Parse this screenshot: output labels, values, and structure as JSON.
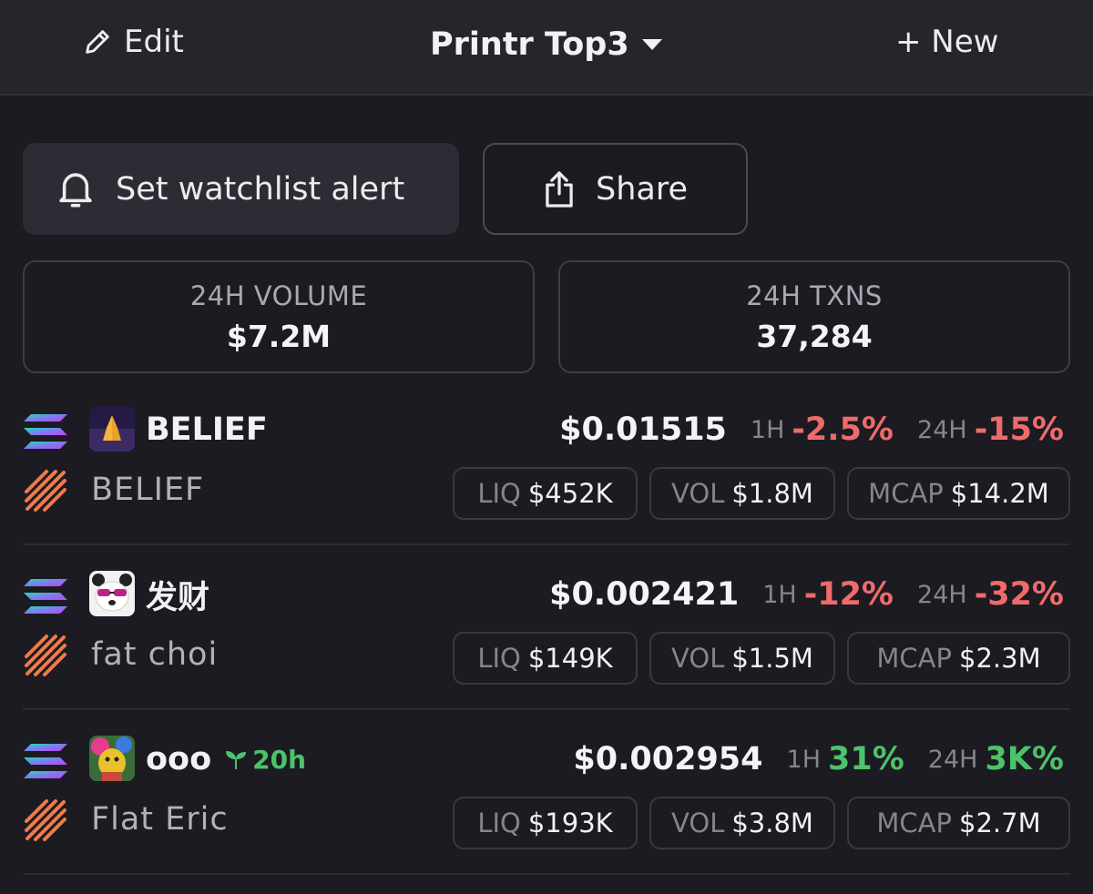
{
  "topbar": {
    "edit_label": "Edit",
    "title": "Printr Top3",
    "new_label": "+ New"
  },
  "actions": {
    "alert_label": "Set watchlist alert",
    "share_label": "Share"
  },
  "stats": {
    "volume": {
      "label": "24H VOLUME",
      "value": "$7.2M"
    },
    "txns": {
      "label": "24H TXNS",
      "value": "37,284"
    }
  },
  "tokens": [
    {
      "ticker": "BELIEF",
      "name": "BELIEF",
      "age": "",
      "price": "$0.01515",
      "h1_label": "1H",
      "h1_change": "-2.5%",
      "h24_label": "24H",
      "h24_change": "-15%",
      "liq_label": "LIQ",
      "liq": "$452K",
      "vol_label": "VOL",
      "vol": "$1.8M",
      "mcap_label": "MCAP",
      "mcap": "$14.2M",
      "avatar_icon": "praying-hands-icon"
    },
    {
      "ticker": "发财",
      "name": "fat choi",
      "age": "",
      "price": "$0.002421",
      "h1_label": "1H",
      "h1_change": "-12%",
      "h24_label": "24H",
      "h24_change": "-32%",
      "liq_label": "LIQ",
      "liq": "$149K",
      "vol_label": "VOL",
      "vol": "$1.5M",
      "mcap_label": "MCAP",
      "mcap": "$2.3M",
      "avatar_icon": "panda-icon"
    },
    {
      "ticker": "ooo",
      "name": "Flat Eric",
      "age": "20h",
      "price": "$0.002954",
      "h1_label": "1H",
      "h1_change": "31%",
      "h24_label": "24H",
      "h24_change": "3K%",
      "liq_label": "LIQ",
      "liq": "$193K",
      "vol_label": "VOL",
      "vol": "$3.8M",
      "mcap_label": "MCAP",
      "mcap": "$2.7M",
      "avatar_icon": "puppet-icon"
    }
  ],
  "colors": {
    "background": "#1b1b21",
    "topbar": "#25262c",
    "negative": "#ef6b6b",
    "positive": "#4cc26b",
    "muted": "#85868e"
  }
}
